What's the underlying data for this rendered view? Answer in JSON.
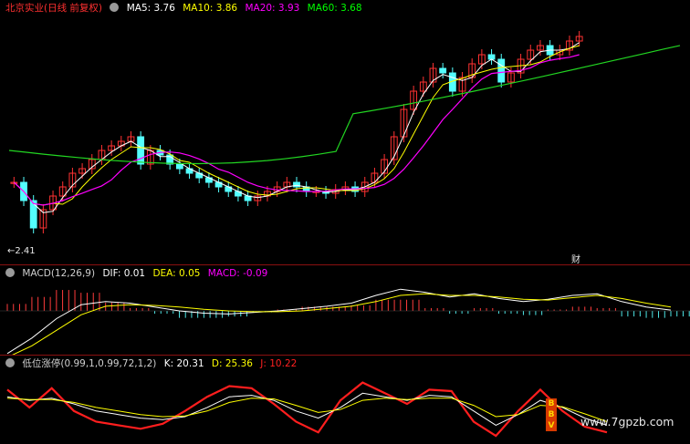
{
  "main_panel": {
    "stock_name": "北京实业(日线 前复权)",
    "indicators": [
      {
        "label": "MA5: 3.76",
        "color": "#ffffff"
      },
      {
        "label": "MA10: 3.86",
        "color": "#ffff00"
      },
      {
        "label": "MA20: 3.93",
        "color": "#ff00ff"
      },
      {
        "label": "MA60: 3.68",
        "color": "#00ff00"
      }
    ],
    "low_label": "←2.41",
    "cai_label": "财"
  },
  "macd_panel": {
    "name": "MACD(12,26,9)",
    "indicators": [
      {
        "label": "DIF: 0.01",
        "color": "#ffffff"
      },
      {
        "label": "DEA: 0.05",
        "color": "#ffff00"
      },
      {
        "label": "MACD: -0.09",
        "color": "#ff00ff"
      }
    ]
  },
  "kdj_panel": {
    "name": "低位涨停(0.99,1,0.99,72,1,2)",
    "indicators": [
      {
        "label": "K: 20.31",
        "color": "#ffffff"
      },
      {
        "label": "D: 25.36",
        "color": "#ffff00"
      },
      {
        "label": "J: 10.22",
        "color": "#ff2020"
      }
    ]
  },
  "watermark": "www.7gpzb.com",
  "chart_data": {
    "type": "line",
    "price": {
      "candles": [
        3.1,
        2.9,
        2.6,
        2.8,
        2.95,
        3.05,
        3.2,
        3.25,
        3.35,
        3.45,
        3.5,
        3.55,
        3.6,
        3.3,
        3.45,
        3.4,
        3.3,
        3.25,
        3.2,
        3.15,
        3.1,
        3.05,
        3.0,
        2.95,
        2.9,
        2.95,
        3.0,
        3.05,
        3.1,
        3.05,
        3.0,
        3.0,
        2.98,
        3.02,
        3.05,
        3.0,
        3.1,
        3.2,
        3.35,
        3.6,
        3.9,
        4.1,
        4.2,
        4.35,
        4.3,
        4.1,
        4.25,
        4.4,
        4.5,
        4.45,
        4.2,
        4.3,
        4.45,
        4.55,
        4.6,
        4.5,
        4.55,
        4.65,
        4.7
      ],
      "ma60_start": 3.45,
      "ma60_end": 4.55,
      "low_value": 2.41
    },
    "macd": {
      "dif": [
        -0.55,
        -0.35,
        -0.1,
        0.08,
        0.12,
        0.1,
        0.05,
        0.0,
        -0.03,
        -0.04,
        -0.02,
        0.0,
        0.03,
        0.06,
        0.1,
        0.2,
        0.28,
        0.24,
        0.18,
        0.22,
        0.16,
        0.12,
        0.15,
        0.2,
        0.22,
        0.12,
        0.05,
        0.01
      ],
      "dea": [
        -0.6,
        -0.45,
        -0.25,
        -0.05,
        0.06,
        0.08,
        0.07,
        0.05,
        0.02,
        0.0,
        -0.01,
        -0.01,
        0.0,
        0.03,
        0.06,
        0.12,
        0.2,
        0.22,
        0.2,
        0.2,
        0.18,
        0.15,
        0.14,
        0.17,
        0.2,
        0.16,
        0.1,
        0.05
      ]
    },
    "kdj": {
      "k": [
        60,
        55,
        58,
        50,
        40,
        35,
        30,
        28,
        32,
        45,
        60,
        62,
        55,
        40,
        30,
        45,
        65,
        60,
        55,
        62,
        60,
        40,
        20,
        35,
        55,
        45,
        30,
        20
      ],
      "d": [
        58,
        56,
        56,
        52,
        45,
        40,
        35,
        32,
        33,
        40,
        52,
        58,
        57,
        48,
        38,
        42,
        55,
        58,
        56,
        58,
        58,
        48,
        32,
        35,
        48,
        46,
        36,
        25
      ],
      "j": [
        70,
        45,
        72,
        40,
        25,
        20,
        15,
        22,
        40,
        60,
        75,
        72,
        50,
        25,
        10,
        55,
        80,
        65,
        50,
        70,
        68,
        25,
        5,
        40,
        70,
        40,
        18,
        10
      ]
    }
  }
}
